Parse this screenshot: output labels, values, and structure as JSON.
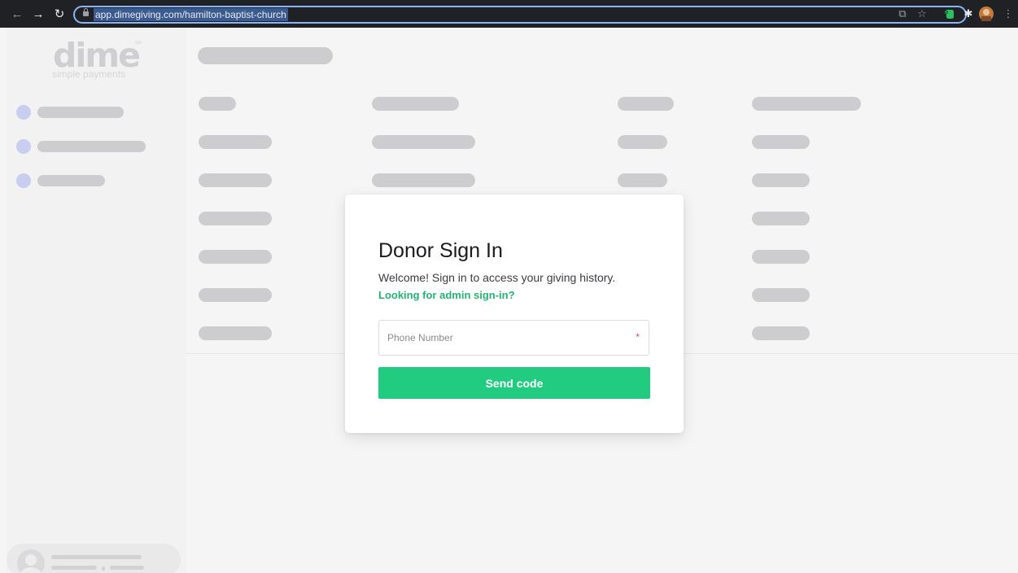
{
  "browser": {
    "url": "app.dimegiving.com/hamilton-baptist-church",
    "back_glyph": "←",
    "forward_glyph": "→",
    "reload_glyph": "↻",
    "share_glyph": "⧉",
    "star_glyph": "☆",
    "extension_glyph": "✱",
    "menu_glyph": "⋮"
  },
  "sidebar": {
    "logo": "dime",
    "logo_tm": "SM",
    "tagline": "simple payments"
  },
  "modal": {
    "title": "Donor Sign In",
    "subtitle": "Welcome! Sign in to access your giving history.",
    "admin_link": "Looking for admin sign-in?",
    "phone_placeholder": "Phone Number",
    "required_marker": "*",
    "send_button": "Send code"
  },
  "colors": {
    "accent_green": "#21cc80",
    "link_green": "#22b573",
    "required_red": "#e0455a",
    "skeleton_gray": "#cdcdcf",
    "nav_dot": "#c9cdf0"
  }
}
